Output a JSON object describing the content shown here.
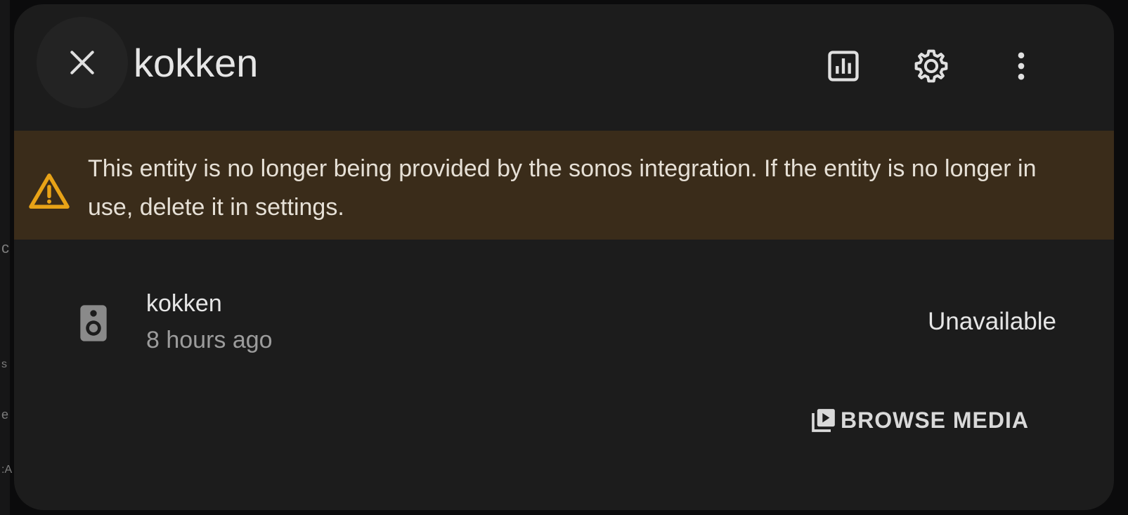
{
  "dialog": {
    "title": "kokken",
    "close_icon": "close-icon",
    "actions": [
      {
        "name": "history",
        "icon": "chart-box-icon"
      },
      {
        "name": "settings",
        "icon": "gear-icon"
      },
      {
        "name": "more",
        "icon": "dots-vertical-icon"
      }
    ]
  },
  "warning": {
    "icon": "alert-triangle-icon",
    "text": "This entity is no longer being provided by the sonos integration. If the entity is no longer in use, delete it in settings.",
    "color": "#e8a317"
  },
  "entity": {
    "icon": "speaker-icon",
    "name": "kokken",
    "last_changed": "8 hours ago",
    "state": "Unavailable"
  },
  "browse_media": {
    "icon": "play-box-multiple-icon",
    "label": "BROWSE MEDIA"
  },
  "colors": {
    "dialog_bg": "#1c1c1c",
    "warning_bg": "#3a2c1a",
    "text_primary": "#e6e6e6",
    "text_secondary": "#9c9c9c"
  }
}
